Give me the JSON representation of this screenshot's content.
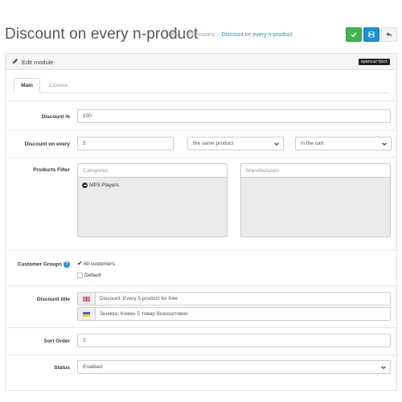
{
  "header": {
    "title": "Discount on every n-product",
    "breadcrumb": [
      "Home",
      "Extensions",
      "Discount on every n-product"
    ],
    "breadcrumb_separator": "›",
    "buttons": [
      {
        "name": "save",
        "icon": "check-icon",
        "color": "#3fb34f"
      },
      {
        "name": "apply",
        "icon": "save-icon",
        "color": "#1e91cf"
      },
      {
        "name": "back",
        "icon": "reply-icon",
        "color": "#f5f5f5"
      }
    ]
  },
  "panel": {
    "title": "Edit module",
    "icon": "pencil-icon",
    "badge": "opencartbot"
  },
  "tabs": [
    {
      "label": "Main",
      "active": true
    },
    {
      "label": "License",
      "active": false
    }
  ],
  "form": {
    "discount_percent": {
      "label": "Discount %",
      "value": "100"
    },
    "discount_on_every": {
      "label": "Discount on every",
      "value": "5",
      "product_select": "the same product",
      "location_select": "in the cart"
    },
    "products_filter": {
      "label": "Products Filter",
      "categories_placeholder": "Categories",
      "categories_selected": [
        "MP3 Players"
      ],
      "manufacturers_placeholder": "Manufacturers",
      "manufacturers_selected": []
    },
    "customer_groups": {
      "label": "Customer Groups",
      "options": [
        {
          "label": "All customers",
          "checked": true
        },
        {
          "label": "Default",
          "checked": false
        }
      ]
    },
    "discount_title": {
      "label": "Discount title",
      "translations": [
        {
          "lang": "English",
          "value": "Discount: Every 5 product for free"
        },
        {
          "lang": "Ukrainian",
          "value": "Знижка: Кожен 5 товар безкоштовно"
        }
      ]
    },
    "sort_order": {
      "label": "Sort Order",
      "value": "2"
    },
    "status": {
      "label": "Status",
      "value": "Enabled"
    }
  },
  "colors": {
    "primary": "#1e91cf",
    "success": "#3fb34f",
    "border": "#cccccc",
    "muted_bg": "#ebebeb"
  }
}
